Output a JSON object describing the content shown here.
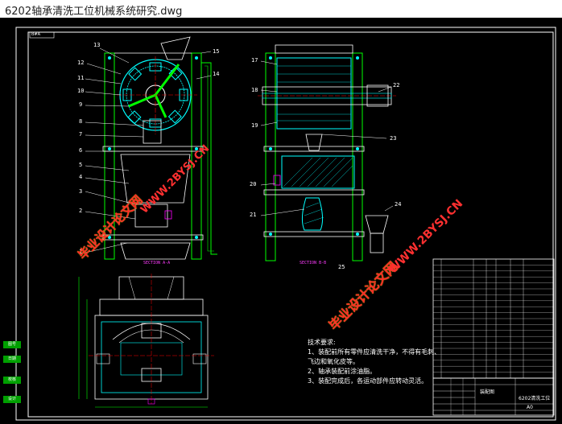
{
  "window": {
    "title": "6202轴承清洗工位机械系统研究.dwg"
  },
  "drawing": {
    "title_block_name": "6202清洗工位",
    "title_block_sub": "A0",
    "section_a": "SECTION A-A",
    "section_b": "SECTION B-B",
    "frame_tag": "B#A",
    "title_small": "装配图"
  },
  "callouts_left": [
    "13",
    "12",
    "11",
    "10",
    "9",
    "8",
    "7",
    "6",
    "5",
    "4",
    "3",
    "2",
    "1"
  ],
  "callouts_right_left": [
    "15",
    "14"
  ],
  "callouts_mid": [
    "17",
    "18",
    "19",
    "20",
    "21"
  ],
  "callouts_mid_right": [
    "22",
    "23",
    "24",
    "25"
  ],
  "watermarks": {
    "cn": "毕业设计论文网",
    "url": "WWW.2BYSJ.CN"
  },
  "notes": {
    "heading": "技术要求:",
    "items": [
      "1、装配前所有零件应清洗干净，不得有毛刺、",
      "   飞边和氧化皮等。",
      "2、轴承装配前涂油脂。",
      "3、装配完成后，各运动部件应转动灵活。"
    ]
  },
  "sidebar_tabs": [
    "图号",
    "日期",
    "校核",
    "设计"
  ],
  "bom_rows": 20,
  "colors": {
    "frame": "#ffffff",
    "outline": "#00ff00",
    "detail": "#00ffff",
    "hatch": "#00ffff",
    "accent": "#ff00ff",
    "dim": "#ffff00",
    "red": "#ff0000"
  }
}
